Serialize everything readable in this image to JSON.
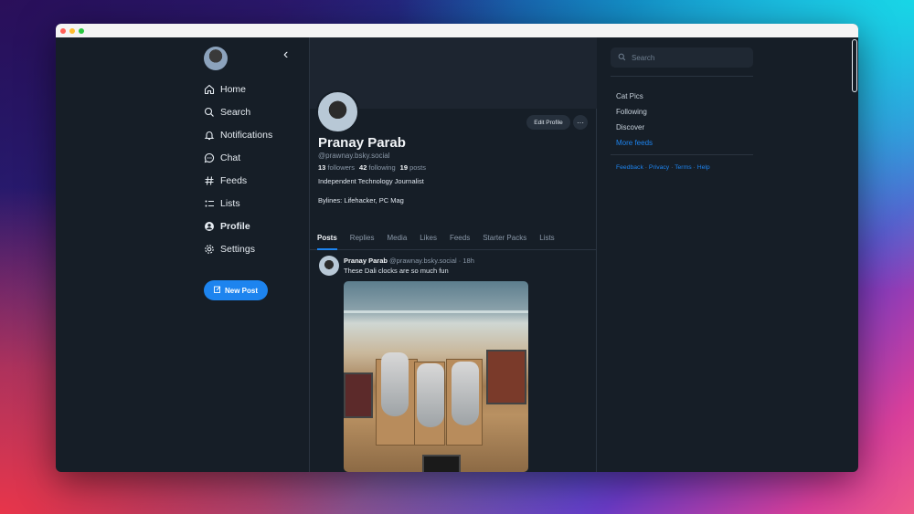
{
  "nav": {
    "items": [
      {
        "label": "Home",
        "icon": "home-icon"
      },
      {
        "label": "Search",
        "icon": "search-icon"
      },
      {
        "label": "Notifications",
        "icon": "bell-icon"
      },
      {
        "label": "Chat",
        "icon": "chat-icon"
      },
      {
        "label": "Feeds",
        "icon": "hash-icon"
      },
      {
        "label": "Lists",
        "icon": "list-icon"
      },
      {
        "label": "Profile",
        "icon": "profile-icon"
      },
      {
        "label": "Settings",
        "icon": "gear-icon"
      }
    ],
    "active": "Profile",
    "new_post_label": "New Post"
  },
  "profile": {
    "name": "Pranay Parab",
    "handle": "@prawnay.bsky.social",
    "followers_count": "13",
    "followers_label": "followers",
    "following_count": "42",
    "following_label": "following",
    "posts_count": "19",
    "posts_label": "posts",
    "bio_line1": "Independent Technology Journalist",
    "bio_line2": "Bylines: Lifehacker, PC Mag",
    "edit_label": "Edit Profile",
    "more_label": "···"
  },
  "tabs": [
    "Posts",
    "Replies",
    "Media",
    "Likes",
    "Feeds",
    "Starter Packs",
    "Lists"
  ],
  "active_tab": "Posts",
  "post": {
    "author": "Pranay Parab",
    "handle": "@prawnay.bsky.social",
    "time": "· 18h",
    "text": "These Dali clocks are so much fun"
  },
  "right": {
    "search_placeholder": "Search",
    "feeds": [
      "Cat Pics",
      "Following",
      "Discover"
    ],
    "more_feeds": "More feeds",
    "footer": [
      "Feedback",
      "Privacy",
      "Terms",
      "Help"
    ]
  },
  "colors": {
    "accent": "#1d84ef",
    "background": "#161e27"
  }
}
